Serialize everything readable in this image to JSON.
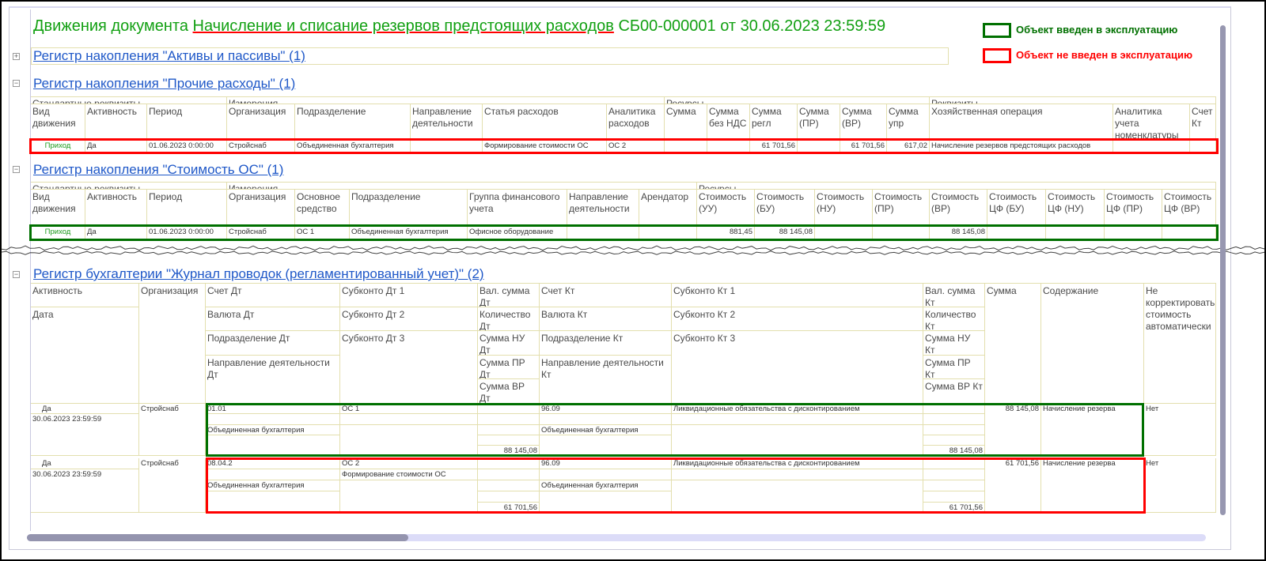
{
  "header": {
    "prefix": "Движения документа ",
    "doc_link": "Начисление и списание резервов предстоящих расходов",
    "suffix": " СБ00-000001 от 30.06.2023 23:59:59"
  },
  "legend": [
    {
      "label": "Объект введен в эксплуатацию",
      "color": "#007000"
    },
    {
      "label": "Объект не введен в эксплуатацию",
      "color": "#ff0000"
    }
  ],
  "colors": {
    "title": "#12a012",
    "link": "#1f58c8",
    "grid": "#e3dfae",
    "movement": "#1a9a1a"
  },
  "sections": {
    "assets": {
      "title": "Регистр накопления \"Активы и пассивы\" (1)",
      "collapsed": true
    },
    "other": {
      "title": "Регистр накопления \"Прочие расходы\" (1)",
      "groups": [
        "Стандартные реквизиты",
        "Измерения",
        "Ресурсы",
        "Реквизиты"
      ],
      "headers": [
        "Вид движения",
        "Активность",
        "Период",
        "Организация",
        "Подразделение",
        "Направление деятельности",
        "Статья расходов",
        "Аналитика расходов",
        "Сумма",
        "Сумма без НДС",
        "Сумма регл",
        "Сумма (ПР)",
        "Сумма (ВР)",
        "Сумма упр",
        "Хозяйственная операция",
        "Аналитика учета номенклатуры",
        "Счет Кт"
      ],
      "row": [
        "Приход",
        "Да",
        "01.06.2023 0:00:00",
        "Стройснаб",
        "Объединенная бухгалтерия",
        "",
        "Формирование стоимости ОС",
        "ОС 2",
        "",
        "",
        "61 701,56",
        "",
        "61 701,56",
        "617,02",
        "Начисление резервов предстоящих расходов",
        "",
        ""
      ],
      "status": "not_in_operation"
    },
    "cost": {
      "title": "Регистр накопления \"Стоимость ОС\" (1)",
      "groups": [
        "Стандартные реквизиты",
        "Измерения",
        "Ресурсы"
      ],
      "headers": [
        "Вид движения",
        "Активность",
        "Период",
        "Организация",
        "Основное средство",
        "Подразделение",
        "Группа финансового учета",
        "Направление деятельности",
        "Арендатор",
        "Стоимость (УУ)",
        "Стоимость (БУ)",
        "Стоимость (НУ)",
        "Стоимость (ПР)",
        "Стоимость (ВР)",
        "Стоимость ЦФ (БУ)",
        "Стоимость ЦФ (НУ)",
        "Стоимость ЦФ (ПР)",
        "Стоимость ЦФ (ВР)"
      ],
      "row": [
        "Приход",
        "Да",
        "01.06.2023 0:00:00",
        "Стройснаб",
        "ОС 1",
        "Объединенная бухгалтерия",
        "Офисное оборудование",
        "",
        "",
        "881,45",
        "88 145,08",
        "",
        "",
        "88 145,08",
        "",
        "",
        "",
        ""
      ],
      "status": "in_operation"
    },
    "journal": {
      "title": "Регистр бухгалтерии \"Журнал проводок (регламентированный учет)\" (2)",
      "headers": {
        "active": "Активность",
        "date": "Дата",
        "org": "Организация",
        "acc_dt": "Счет Дт",
        "cur_dt": "Валюта Дт",
        "div_dt": "Подразделение Дт",
        "dir_dt": "Направление деятельности Дт",
        "sub_dt1": "Субконто Дт 1",
        "sub_dt2": "Субконто Дт 2",
        "sub_dt3": "Субконто Дт 3",
        "val_dt": "Вал. сумма Дт",
        "qty_dt": "Количество Дт",
        "nu_dt": "Сумма НУ Дт",
        "pr_dt": "Сумма ПР Дт",
        "vr_dt": "Сумма ВР Дт",
        "acc_kt": "Счет Кт",
        "cur_kt": "Валюта Кт",
        "div_kt": "Подразделение Кт",
        "dir_kt": "Направление деятельности Кт",
        "sub_kt1": "Субконто Кт 1",
        "sub_kt2": "Субконто Кт 2",
        "sub_kt3": "Субконто Кт 3",
        "val_kt": "Вал. сумма Кт",
        "qty_kt": "Количество Кт",
        "nu_kt": "Сумма НУ Кт",
        "pr_kt": "Сумма ПР Кт",
        "vr_kt": "Сумма ВР Кт",
        "sum": "Сумма",
        "content": "Содержание",
        "nocorr": "Не корректировать стоимость автоматически"
      },
      "rows": [
        {
          "status": "in_operation",
          "active": "Да",
          "date": "30.06.2023 23:59:59",
          "org": "Стройснаб",
          "acc_dt": "01.01",
          "cur_dt": "",
          "div_dt": "Объединенная бухгалтерия",
          "dir_dt": "",
          "sub_dt1": "ОС 1",
          "sub_dt2": "",
          "sub_dt3": "",
          "val_dt": "",
          "qty_dt": "",
          "nu_dt": "",
          "pr_dt": "",
          "vr_dt": "88 145,08",
          "acc_kt": "96.09",
          "cur_kt": "",
          "div_kt": "Объединенная бухгалтерия",
          "dir_kt": "",
          "sub_kt1": "Ликвидационные обязательства с дисконтированием",
          "sub_kt2": "",
          "sub_kt3": "",
          "val_kt": "",
          "qty_kt": "",
          "nu_kt": "",
          "pr_kt": "",
          "vr_kt": "88 145,08",
          "sum": "88 145,08",
          "content": "Начисление резерва",
          "nocorr": "Нет"
        },
        {
          "status": "not_in_operation",
          "active": "Да",
          "date": "30.06.2023 23:59:59",
          "org": "Стройснаб",
          "acc_dt": "08.04.2",
          "cur_dt": "",
          "div_dt": "Объединенная бухгалтерия",
          "dir_dt": "",
          "sub_dt1": "ОС 2",
          "sub_dt2": "Формирование стоимости ОС",
          "sub_dt3": "",
          "val_dt": "",
          "qty_dt": "",
          "nu_dt": "",
          "pr_dt": "",
          "vr_dt": "61 701,56",
          "acc_kt": "96.09",
          "cur_kt": "",
          "div_kt": "Объединенная бухгалтерия",
          "dir_kt": "",
          "sub_kt1": "Ликвидационные обязательства с дисконтированием",
          "sub_kt2": "",
          "sub_kt3": "",
          "val_kt": "",
          "qty_kt": "",
          "nu_kt": "",
          "pr_kt": "",
          "vr_kt": "61 701,56",
          "sum": "61 701,56",
          "content": "Начисление резерва",
          "nocorr": "Нет"
        }
      ]
    }
  },
  "scroll": {
    "horizontal_position_percent": 0
  }
}
